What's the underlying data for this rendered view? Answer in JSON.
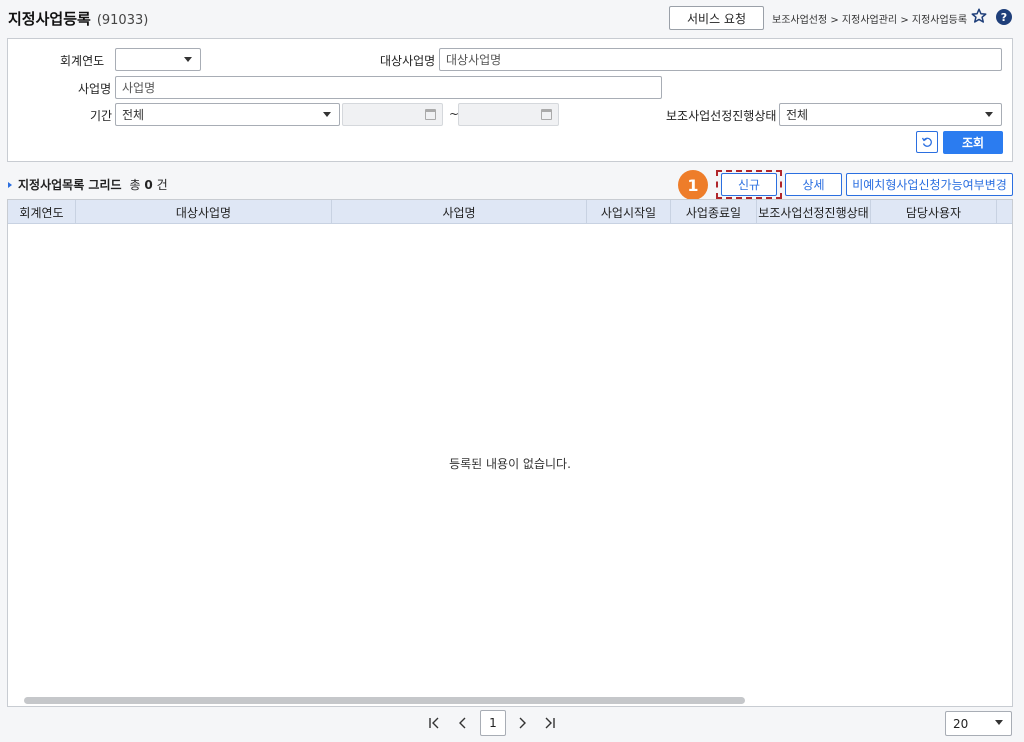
{
  "header": {
    "title": "지정사업등록",
    "code": "(91033)",
    "service_request_label": "서비스 요청",
    "breadcrumb": "보조사업선정 > 지정사업관리 > 지정사업등록",
    "help_label": "?"
  },
  "search": {
    "fiscal_year_label": "회계연도",
    "fiscal_year_value": "",
    "target_business_label": "대상사업명",
    "target_business_placeholder": "대상사업명",
    "business_name_label": "사업명",
    "business_name_placeholder": "사업명",
    "period_label": "기간",
    "period_type_value": "전체",
    "period_start": "",
    "period_end": "",
    "period_separator": "~",
    "status_label": "보조사업선정진행상태",
    "status_value": "전체",
    "query_label": "조회"
  },
  "grid_section": {
    "title": "지정사업목록 그리드",
    "count_prefix": "총",
    "count_value": "0",
    "count_suffix": "건",
    "step_badge": "1",
    "new_label": "신규",
    "detail_label": "상세",
    "change_label": "비예치형사업신청가능여부변경"
  },
  "grid": {
    "columns": [
      "회계연도",
      "대상사업명",
      "사업명",
      "사업시작일",
      "사업종료일",
      "보조사업선정진행상태",
      "담당사용자"
    ],
    "rows": [],
    "empty_message": "등록된 내용이 없습니다."
  },
  "pager": {
    "current_page": "1",
    "page_size": "20"
  },
  "colors": {
    "accent": "#2b7cf0",
    "badge": "#ee7d2a",
    "highlight": "#b0262b",
    "grid_header": "#dfe7f5"
  }
}
